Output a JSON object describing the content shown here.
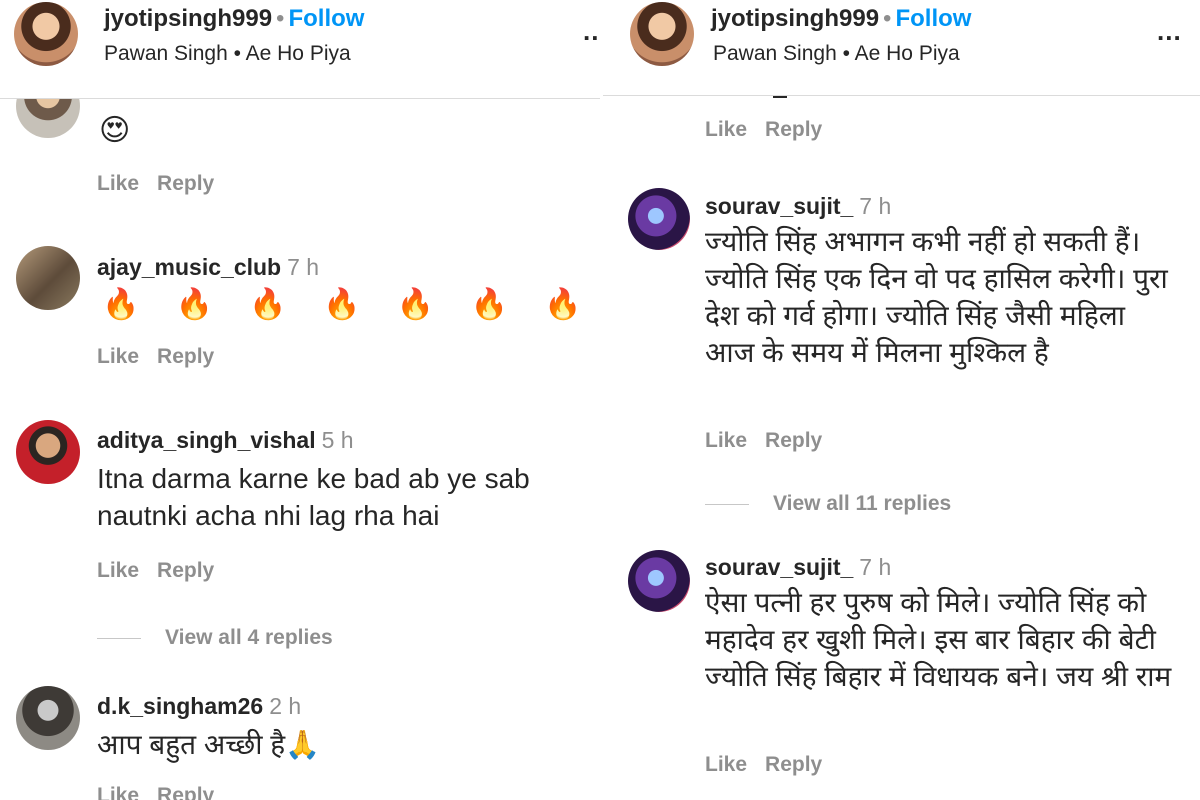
{
  "header": {
    "username": "jyotipsingh999",
    "separator": "•",
    "follow_label": "Follow",
    "audio": "Pawan Singh • Ae Ho Piya",
    "more": "..."
  },
  "actions": {
    "like": "Like",
    "reply": "Reply"
  },
  "left": {
    "comments": [
      {
        "username": "",
        "time": "",
        "text": "😍"
      },
      {
        "username": "ajay_music_club",
        "time": "7 h",
        "text": "🔥 🔥 🔥 🔥 🔥 🔥 🔥"
      },
      {
        "username": "aditya_singh_vishal",
        "time": "5 h",
        "text": "Itna darma karne ke bad ab ye sab nautnki acha nhi lag rha hai",
        "view_replies": "View all 4 replies"
      },
      {
        "username": "d.k_singham26",
        "time": "2 h",
        "text": "आप बहुत अच्छी है🙏"
      }
    ]
  },
  "right": {
    "comments": [
      {
        "username": "sourav_sujit_",
        "time": "7 h",
        "text": "ज्योति सिंह अभागन कभी नहीं हो सकती हैं। ज्योति सिंह एक दिन वो पद हासिल करेगी। पुरा देश को गर्व होगा। ज्योति सिंह जैसी महिला आज के समय में मिलना मुश्किल है",
        "view_replies": "View all 11 replies"
      },
      {
        "username": "sourav_sujit_",
        "time": "7 h",
        "text": "ऐसा पत्नी हर पुरुष को मिले। ज्योति सिंह को महादेव हर खुशी मिले। इस बार बिहार की बेटी ज्योति सिंह बिहार में विधायक बने। जय श्री राम"
      }
    ]
  }
}
